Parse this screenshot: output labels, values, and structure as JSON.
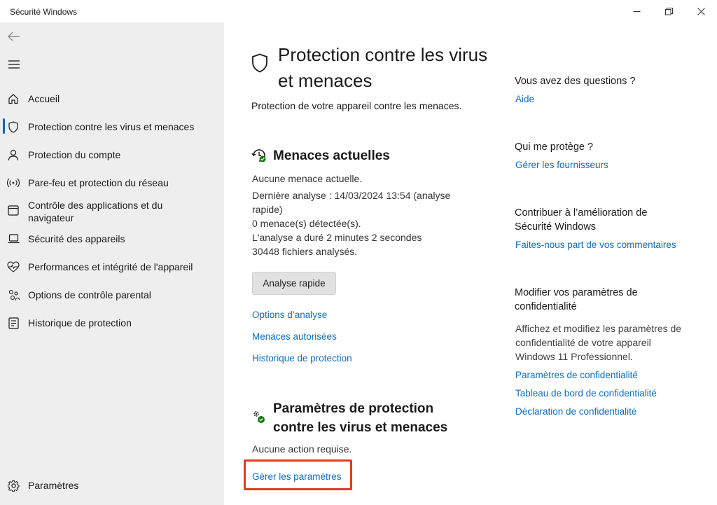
{
  "window": {
    "title": "Sécurité Windows",
    "controls": [
      "minimize-icon",
      "restore-icon",
      "close-icon"
    ]
  },
  "sidebar": {
    "back_icon": "arrow-left-icon",
    "menu_icon": "hamburger-menu-icon",
    "items": [
      {
        "label": "Accueil",
        "icon": "home-icon",
        "active": false
      },
      {
        "label": "Protection contre les virus et menaces",
        "icon": "shield-icon",
        "active": true
      },
      {
        "label": "Protection du compte",
        "icon": "person-icon",
        "active": false
      },
      {
        "label": "Pare-feu et protection du réseau",
        "icon": "wifi-signal-icon",
        "active": false
      },
      {
        "label": "Contrôle des applications et du navigateur",
        "icon": "app-window-icon",
        "active": false
      },
      {
        "label": "Sécurité des appareils",
        "icon": "laptop-icon",
        "active": false
      },
      {
        "label": "Performances et intégrité de l'appareil",
        "icon": "heart-pulse-icon",
        "active": false
      },
      {
        "label": "Options de contrôle parental",
        "icon": "family-icon",
        "active": false
      },
      {
        "label": "Historique de protection",
        "icon": "history-icon",
        "active": false
      }
    ],
    "settings_label": "Paramètres"
  },
  "main": {
    "title": "Protection contre les virus et menaces",
    "subtitle": "Protection de votre appareil contre les menaces.",
    "threats": {
      "title": "Menaces actuelles",
      "line1": "Aucune menace actuelle.",
      "line2": "Dernière analyse : 14/03/2024 13:54 (analyse rapide)",
      "line3": "0 menace(s) détectée(s).",
      "line4": "L'analyse a duré 2 minutes 2 secondes",
      "line5": "30448 fichiers analysés.",
      "button": "Analyse rapide",
      "links": [
        "Options d’analyse",
        "Menaces autorisées",
        "Historique de protection"
      ]
    },
    "settings": {
      "title": "Paramètres de protection contre les virus et menaces",
      "status": "Aucune action requise.",
      "manage_link": "Gérer les paramètres"
    }
  },
  "right": {
    "questions": {
      "heading": "Vous avez des questions ?",
      "link": "Aide"
    },
    "who": {
      "heading": "Qui me protège ?",
      "link": "Gérer les fournisseurs"
    },
    "contribute": {
      "heading": "Contribuer à l’amélioration de Sécurité Windows",
      "link": "Faites-nous part de vos commentaires"
    },
    "privacy": {
      "heading": "Modifier vos paramètres de confidentialité",
      "text": "Affichez et modifiez les paramètres de confidentialité de votre appareil Windows 11 Professionnel.",
      "links": [
        "Paramètres de confidentialité",
        "Tableau de bord de confidentialité",
        "Déclaration de confidentialité"
      ]
    }
  },
  "colors": {
    "accent": "#0067c0",
    "link": "#0f6cbd",
    "highlight": "#e23b1f",
    "sidebar_bg": "#eeeeee",
    "status_green": "#107c10"
  }
}
